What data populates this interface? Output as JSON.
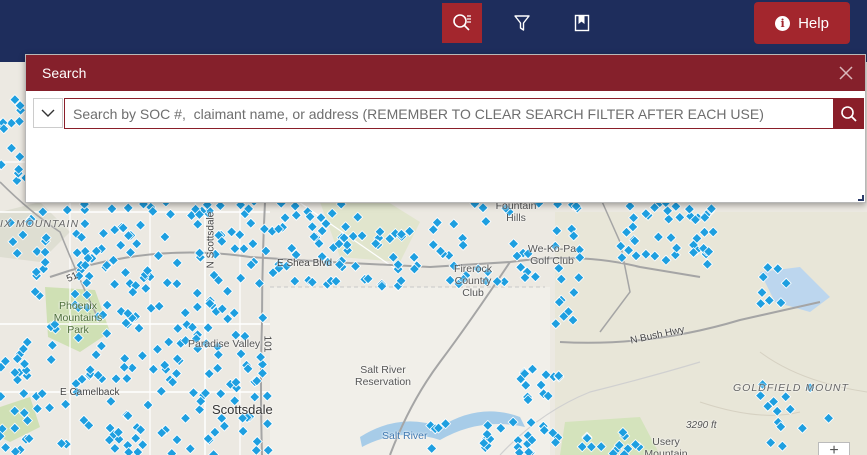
{
  "toolbar": {
    "help_label": "Help",
    "buttons": [
      {
        "name": "search-tool-button",
        "icon": "search-list-icon",
        "active": true
      },
      {
        "name": "filter-tool-button",
        "icon": "filter-icon",
        "active": false
      },
      {
        "name": "bookmark-tool-button",
        "icon": "bookmark-icon",
        "active": false
      }
    ]
  },
  "search_panel": {
    "title": "Search",
    "placeholder": "Search by SOC #,  claimant name, or address (REMEMBER TO CLEAR SEARCH FILTER AFTER EACH USE)",
    "value": ""
  },
  "map": {
    "labels": {
      "camelback_mountain": "IX MOUNTAIN",
      "phoenix_mountains_park": "Phoenix Mountains Park",
      "fountain_hills": "Fountain Hills",
      "we_ko_pa_golf_club": "We-Ko-Pa Golf Club",
      "firerock_country_club": "Firerock Country Club",
      "e_shea_blvd": "E Shea Blvd",
      "n_scottsdale_rd": "N Scottsdale",
      "salt_river_reservation": "Salt River Reservation",
      "scottsdale": "Scottsdale",
      "paradise_valley": "Paradise Valley",
      "e_camelback": "E Camelback",
      "n_bush_hwy": "N Bush Hwy",
      "goldfield_mountains": "GOLDFIELD MOUNT",
      "elevation": "3290 ft",
      "usery_mountain": "Usery Mountain",
      "salt_river": "Salt River",
      "route_51": "51",
      "route_101": "101"
    },
    "zoom_in_label": "+",
    "colors": {
      "marker": "#1e9fe0",
      "header": "#1e2d5c",
      "accent": "#a3262d"
    }
  }
}
